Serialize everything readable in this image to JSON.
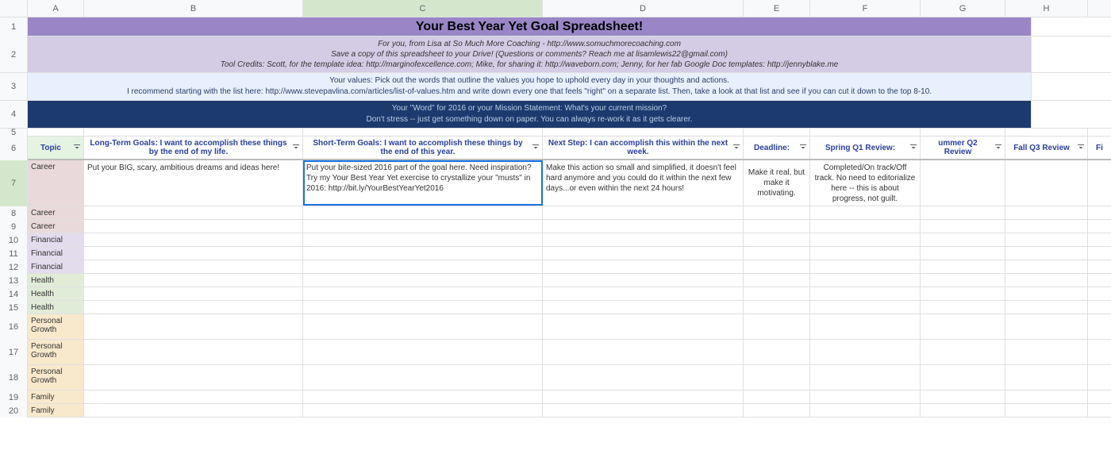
{
  "columns": [
    "A",
    "B",
    "C",
    "D",
    "E",
    "F",
    "G",
    "H",
    ""
  ],
  "title": "Your Best Year Yet Goal Spreadsheet!",
  "subtitle": {
    "line1": "For you, from Lisa at So Much More Coaching - http://www.somuchmorecoaching.com",
    "line2": "Save a copy of this spreadsheet to your Drive! (Questions or comments? Reach me at lisamlewis22@gmail.com)",
    "line3": "Tool Credits: Scott, for the template idea: http://marginofexcellence.com; Mike, for sharing it: http://waveborn.com; Jenny, for her fab Google Doc templates: http://jennyblake.me"
  },
  "values_section": {
    "line1": "Your values: Pick out the words that outline the values you hope to uphold every day in your thoughts and actions.",
    "line2": "I recommend starting with the list here: http://www.stevepavlina.com/articles/list-of-values.htm and write down every one that feels \"right\" on a separate list. Then, take a look at that list and see if you can cut it down to the top 8-10."
  },
  "word_section": {
    "line1": "Your \"Word\" for 2016 or your Mission Statement: What's your current mission?",
    "line2": "Don't stress -- just get something down on paper. You can always re-work it as it gets clearer."
  },
  "headers": {
    "topic": "Topic",
    "long_term": "Long-Term Goals:  I want to accomplish these things by the end of my life.",
    "short_term": "Short-Term Goals:  I want to accomplish these things by the end of this year.",
    "next_step": "Next Step: I can accomplish this within the next week.",
    "deadline": "Deadline:",
    "spring": "Spring Q1 Review:",
    "summer": "ummer Q2 Review",
    "fall": "Fall Q3 Review",
    "final": "Fi"
  },
  "row7": {
    "topic": "Career",
    "b": "Put your BIG, scary, ambitious dreams and ideas here!",
    "c": "Put your bite-sized 2016 part of the goal here. Need inspiration? Try my Your Best Year Yet exercise to crystallize your \"musts\" in 2016: http://bit.ly/YourBestYearYet2016",
    "d": "Make this action so small and simplified, it doesn't feel hard anymore and you could do it within the next few days...or even within the next 24 hours!",
    "e": "Make it real, but make it motivating.",
    "f": "Completed/On track/Off track. No need to editorialize here -- this is about progress, not guilt."
  },
  "topics": [
    {
      "row": 8,
      "label": "Career",
      "class": "topic-career",
      "tall": false
    },
    {
      "row": 9,
      "label": "Career",
      "class": "topic-career",
      "tall": false
    },
    {
      "row": 10,
      "label": "Financial",
      "class": "topic-financial",
      "tall": false
    },
    {
      "row": 11,
      "label": "Financial",
      "class": "topic-financial",
      "tall": false
    },
    {
      "row": 12,
      "label": "Financial",
      "class": "topic-financial",
      "tall": false
    },
    {
      "row": 13,
      "label": "Health",
      "class": "topic-health",
      "tall": false
    },
    {
      "row": 14,
      "label": "Health",
      "class": "topic-health",
      "tall": false
    },
    {
      "row": 15,
      "label": "Health",
      "class": "topic-health",
      "tall": false
    },
    {
      "row": 16,
      "label": "Personal Growth",
      "class": "topic-personal",
      "tall": true
    },
    {
      "row": 17,
      "label": "Personal Growth",
      "class": "topic-personal",
      "tall": true
    },
    {
      "row": 18,
      "label": "Personal Growth",
      "class": "topic-personal",
      "tall": true
    },
    {
      "row": 19,
      "label": "Family",
      "class": "topic-family",
      "tall": false
    },
    {
      "row": 20,
      "label": "Family",
      "class": "topic-family",
      "tall": false
    }
  ]
}
